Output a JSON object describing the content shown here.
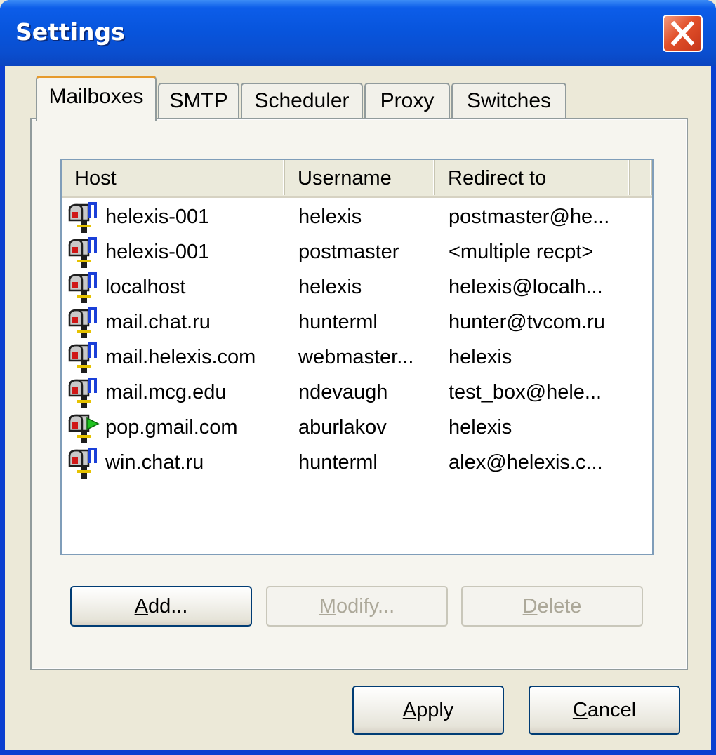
{
  "window": {
    "title": "Settings",
    "close_icon": "close-icon"
  },
  "tabs": [
    {
      "label": "Mailboxes",
      "active": true
    },
    {
      "label": "SMTP",
      "active": false
    },
    {
      "label": "Scheduler",
      "active": false
    },
    {
      "label": "Proxy",
      "active": false
    },
    {
      "label": "Switches",
      "active": false
    }
  ],
  "list": {
    "columns": [
      "Host",
      "Username",
      "Redirect to"
    ],
    "rows": [
      {
        "host": "helexis-001",
        "username": "helexis",
        "redirect": "postmaster@he...",
        "icon": "mailbox-flag-icon"
      },
      {
        "host": "helexis-001",
        "username": "postmaster",
        "redirect": "<multiple recpt>",
        "icon": "mailbox-flag-icon"
      },
      {
        "host": "localhost",
        "username": "helexis",
        "redirect": "helexis@localh...",
        "icon": "mailbox-flag-icon"
      },
      {
        "host": "mail.chat.ru",
        "username": "hunterml",
        "redirect": "hunter@tvcom.ru",
        "icon": "mailbox-flag-icon"
      },
      {
        "host": "mail.helexis.com",
        "username": "webmaster...",
        "redirect": "helexis",
        "icon": "mailbox-flag-icon"
      },
      {
        "host": "mail.mcg.edu",
        "username": "ndevaugh",
        "redirect": "test_box@hele...",
        "icon": "mailbox-flag-icon"
      },
      {
        "host": "pop.gmail.com",
        "username": "aburlakov",
        "redirect": "helexis",
        "icon": "mailbox-play-icon"
      },
      {
        "host": "win.chat.ru",
        "username": "hunterml",
        "redirect": "alex@helexis.c...",
        "icon": "mailbox-flag-icon"
      }
    ]
  },
  "buttons": {
    "add": {
      "mnemonic": "A",
      "rest": "dd...",
      "enabled": true
    },
    "modify": {
      "mnemonic": "M",
      "rest": "odify...",
      "enabled": false
    },
    "delete": {
      "mnemonic": "D",
      "rest": "elete",
      "enabled": false
    },
    "apply": {
      "mnemonic": "A",
      "rest": "pply",
      "enabled": true
    },
    "cancel": {
      "mnemonic": "C",
      "rest": "ancel",
      "enabled": true
    }
  }
}
